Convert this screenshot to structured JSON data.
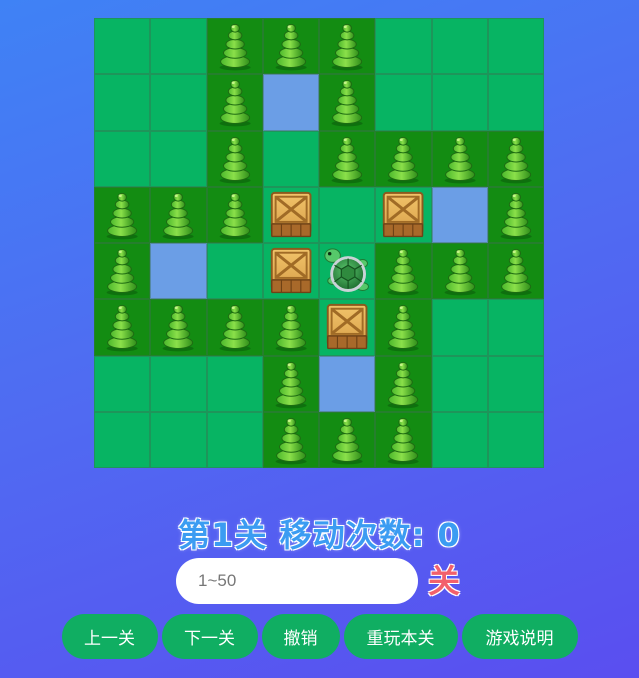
{
  "game": {
    "status": {
      "level_text": "第1关",
      "moves_label": "移动次数:",
      "moves": "0"
    },
    "board": {
      "rows": 8,
      "cols": 8,
      "legend": {
        "G": "grass",
        "T": "tree",
        "D": "target",
        "B": "box",
        "P": "player"
      },
      "grid": [
        "GGTTTGGG",
        "GGTDTGGG",
        "GGTGTTTT",
        "TTTBGBDT",
        "TDGBPTTT",
        "TTTTBTGG",
        "GGGTDTGG",
        "GGGTTTGG"
      ]
    },
    "level_input": {
      "placeholder": "1~50",
      "value": ""
    },
    "go_label": "关",
    "buttons": {
      "prev": "上一关",
      "next": "下一关",
      "undo": "撤销",
      "restart": "重玩本关",
      "help": "游戏说明"
    }
  }
}
